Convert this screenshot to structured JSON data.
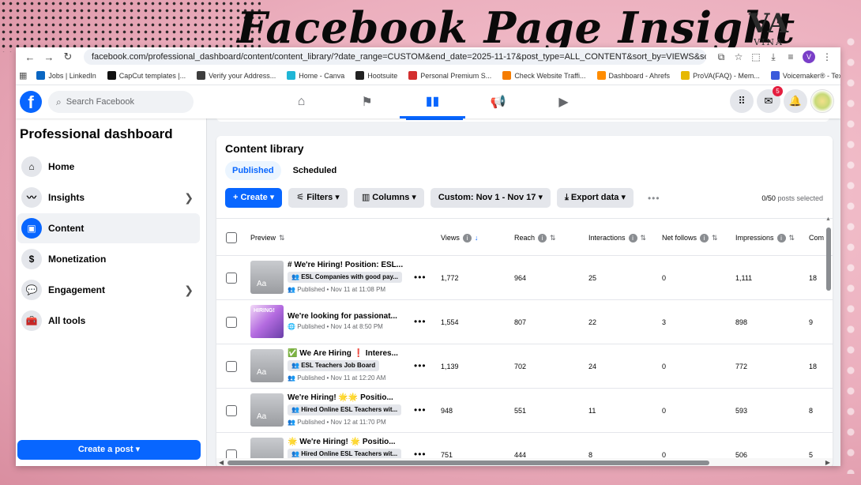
{
  "banner": {
    "title": "Facebook Page Insight",
    "logo_mark": "VA",
    "logo_name": "VINA"
  },
  "browser": {
    "url": "facebook.com/professional_dashboard/content/content_library/?date_range=CUSTOM&end_date=2025-11-17&post_type=ALL_CONTENT&sort_by=VIEWS&sorting_method=...",
    "profile_initial": "V",
    "bookmarks": [
      {
        "label": "Jobs | LinkedIn",
        "color": "#0a66c2"
      },
      {
        "label": "CapCut templates |...",
        "color": "#111111"
      },
      {
        "label": "Verify your Address...",
        "color": "#3d3d3d"
      },
      {
        "label": "Home - Canva",
        "color": "#1fb6d6"
      },
      {
        "label": "Hootsuite",
        "color": "#222222"
      },
      {
        "label": "Personal Premium S...",
        "color": "#d32f2f"
      },
      {
        "label": "Check Website Traffi...",
        "color": "#f57c00"
      },
      {
        "label": "Dashboard - Ahrefs",
        "color": "#ff8c00"
      },
      {
        "label": "ProVA(FAQ) - Mem...",
        "color": "#e6b800"
      },
      {
        "label": "Voicemaker® - Text...",
        "color": "#3b5bdb"
      }
    ]
  },
  "fb": {
    "search_placeholder": "Search Facebook",
    "messenger_badge": "5"
  },
  "sidebar": {
    "title": "Professional dashboard",
    "items": [
      {
        "label": "Home"
      },
      {
        "label": "Insights"
      },
      {
        "label": "Content"
      },
      {
        "label": "Monetization"
      },
      {
        "label": "Engagement"
      },
      {
        "label": "All tools"
      }
    ],
    "create_post": "Create a post"
  },
  "content": {
    "title": "Content library",
    "tabs": [
      "Published",
      "Scheduled"
    ],
    "toolbar": {
      "create": "Create",
      "filters": "Filters",
      "columns": "Columns",
      "date": "Custom: Nov 1 - Nov 17",
      "export": "Export data",
      "selected": "0/50",
      "selected_suffix": "posts selected"
    },
    "columns": [
      "Preview",
      "Views",
      "Reach",
      "Interactions",
      "Net follows",
      "Impressions",
      "Com"
    ],
    "rows": [
      {
        "title": "# We're Hiring! Position: ESL...",
        "tag": "ESL Companies with good pay...",
        "status": "Published • Nov 11 at 11:08 PM",
        "views": "1,772",
        "reach": "964",
        "interactions": "25",
        "net_follows": "0",
        "impressions": "1,111",
        "comments": "18"
      },
      {
        "title": "We're looking for passionat...",
        "tag": "",
        "status": "Published • Nov 14 at 8:50 PM",
        "views": "1,554",
        "reach": "807",
        "interactions": "22",
        "net_follows": "3",
        "impressions": "898",
        "comments": "9"
      },
      {
        "title": "✅ We Are Hiring ❗ Interes...",
        "tag": "ESL Teachers Job Board",
        "status": "Published • Nov 11 at 12:20 AM",
        "views": "1,139",
        "reach": "702",
        "interactions": "24",
        "net_follows": "0",
        "impressions": "772",
        "comments": "18"
      },
      {
        "title": "We're Hiring! 🌟🌟 Positio...",
        "tag": "Hired Online ESL Teachers wit...",
        "status": "Published • Nov 12 at 11:70 PM",
        "views": "948",
        "reach": "551",
        "interactions": "11",
        "net_follows": "0",
        "impressions": "593",
        "comments": "8"
      },
      {
        "title": "🌟 We're Hiring! 🌟 Positio...",
        "tag": "Hired Online ESL Teachers wit...",
        "status": "",
        "views": "751",
        "reach": "444",
        "interactions": "8",
        "net_follows": "0",
        "impressions": "506",
        "comments": "5"
      }
    ],
    "thumb_text": "Aa",
    "thumb_hiring_text": "HIRING!"
  }
}
